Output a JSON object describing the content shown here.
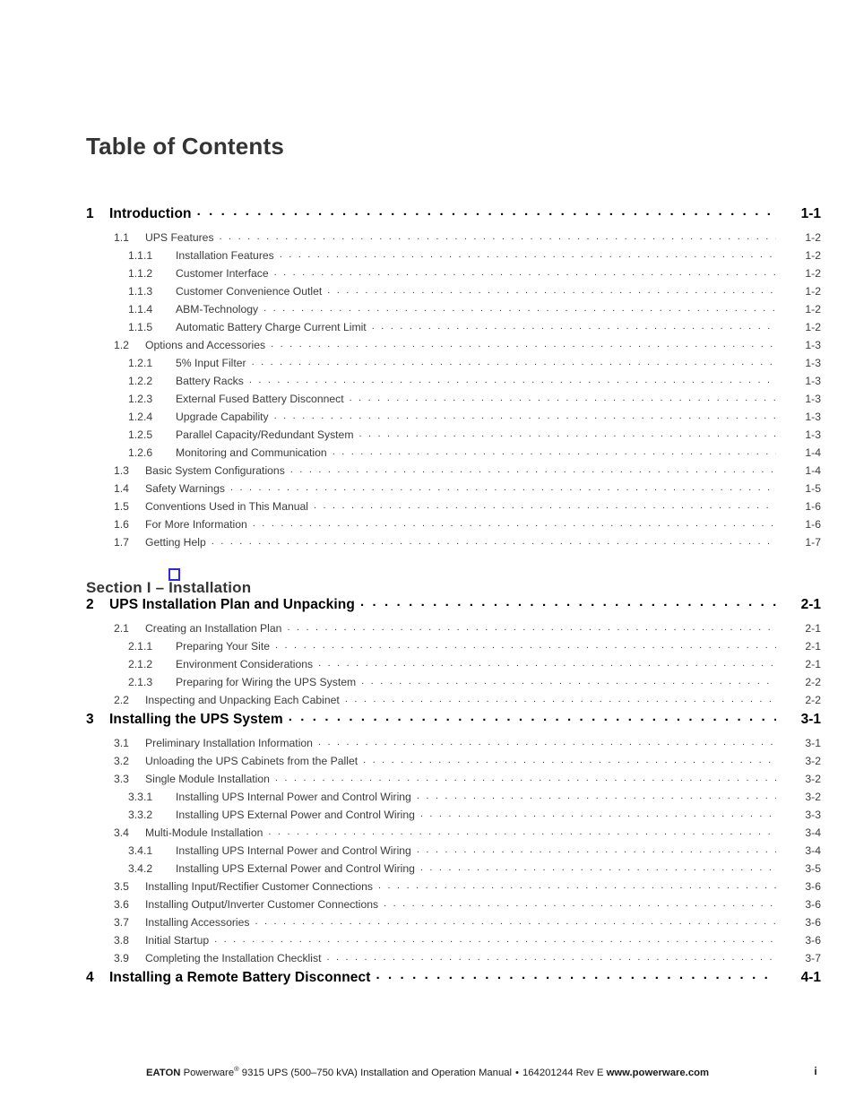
{
  "page_title": "Table of Contents",
  "section_divider": {
    "label": "Section I – Installation"
  },
  "entries": [
    {
      "level": 1,
      "num": "1",
      "label": "Introduction",
      "page": "1-1"
    },
    {
      "level": 2,
      "num": "1.1",
      "label": "UPS Features",
      "page": "1-2"
    },
    {
      "level": 3,
      "num": "1.1.1",
      "label": "Installation Features",
      "page": "1-2"
    },
    {
      "level": 3,
      "num": "1.1.2",
      "label": "Customer Interface",
      "page": "1-2"
    },
    {
      "level": 3,
      "num": "1.1.3",
      "label": "Customer Convenience Outlet",
      "page": "1-2"
    },
    {
      "level": 3,
      "num": "1.1.4",
      "label": "ABM-Technology",
      "page": "1-2"
    },
    {
      "level": 3,
      "num": "1.1.5",
      "label": "Automatic Battery Charge Current Limit",
      "page": "1-2"
    },
    {
      "level": 2,
      "num": "1.2",
      "label": "Options and Accessories",
      "page": "1-3"
    },
    {
      "level": 3,
      "num": "1.2.1",
      "label": "5% Input Filter",
      "page": "1-3"
    },
    {
      "level": 3,
      "num": "1.2.2",
      "label": "Battery Racks",
      "page": "1-3"
    },
    {
      "level": 3,
      "num": "1.2.3",
      "label": "External Fused Battery Disconnect",
      "page": "1-3"
    },
    {
      "level": 3,
      "num": "1.2.4",
      "label": "Upgrade Capability",
      "page": "1-3"
    },
    {
      "level": 3,
      "num": "1.2.5",
      "label": "Parallel Capacity/Redundant System",
      "page": "1-3"
    },
    {
      "level": 3,
      "num": "1.2.6",
      "label": "Monitoring and Communication",
      "page": "1-4"
    },
    {
      "level": 2,
      "num": "1.3",
      "label": "Basic System Configurations",
      "page": "1-4"
    },
    {
      "level": 2,
      "num": "1.4",
      "label": "Safety Warnings",
      "page": "1-5"
    },
    {
      "level": 2,
      "num": "1.5",
      "label": "Conventions Used in This Manual",
      "page": "1-6"
    },
    {
      "level": 2,
      "num": "1.6",
      "label": "For More Information",
      "page": "1-6"
    },
    {
      "level": 2,
      "num": "1.7",
      "label": "Getting Help",
      "page": "1-7"
    },
    {
      "level": 0,
      "num": "",
      "label": "Section I – Installation",
      "page": ""
    },
    {
      "level": 1,
      "num": "2",
      "label": "UPS Installation Plan and Unpacking",
      "page": "2-1"
    },
    {
      "level": 2,
      "num": "2.1",
      "label": "Creating an Installation Plan",
      "page": "2-1"
    },
    {
      "level": 3,
      "num": "2.1.1",
      "label": "Preparing Your Site",
      "page": "2-1"
    },
    {
      "level": 3,
      "num": "2.1.2",
      "label": "Environment Considerations",
      "page": "2-1"
    },
    {
      "level": 3,
      "num": "2.1.3",
      "label": "Preparing for Wiring the UPS System",
      "page": "2-2"
    },
    {
      "level": 2,
      "num": "2.2",
      "label": "Inspecting and Unpacking Each Cabinet",
      "page": "2-2"
    },
    {
      "level": 1,
      "num": "3",
      "label": "Installing the UPS System",
      "page": "3-1"
    },
    {
      "level": 2,
      "num": "3.1",
      "label": "Preliminary Installation Information",
      "page": "3-1"
    },
    {
      "level": 2,
      "num": "3.2",
      "label": "Unloading the UPS Cabinets from the Pallet",
      "page": "3-2"
    },
    {
      "level": 2,
      "num": "3.3",
      "label": "Single Module Installation",
      "page": "3-2"
    },
    {
      "level": 3,
      "num": "3.3.1",
      "label": "Installing UPS Internal Power and Control Wiring",
      "page": "3-2"
    },
    {
      "level": 3,
      "num": "3.3.2",
      "label": "Installing UPS External Power and Control Wiring",
      "page": "3-3"
    },
    {
      "level": 2,
      "num": "3.4",
      "label": "Multi-Module Installation",
      "page": "3-4"
    },
    {
      "level": 3,
      "num": "3.4.1",
      "label": "Installing UPS Internal Power and Control Wiring",
      "page": "3-4"
    },
    {
      "level": 3,
      "num": "3.4.2",
      "label": "Installing UPS External Power and Control Wiring",
      "page": "3-5"
    },
    {
      "level": 2,
      "num": "3.5",
      "label": "Installing Input/Rectifier Customer Connections",
      "page": "3-6"
    },
    {
      "level": 2,
      "num": "3.6",
      "label": "Installing Output/Inverter Customer Connections",
      "page": "3-6"
    },
    {
      "level": 2,
      "num": "3.7",
      "label": "Installing Accessories",
      "page": "3-6"
    },
    {
      "level": 2,
      "num": "3.8",
      "label": "Initial Startup",
      "page": "3-6"
    },
    {
      "level": 2,
      "num": "3.9",
      "label": "Completing the Installation Checklist",
      "page": "3-7"
    },
    {
      "level": 1,
      "num": "4",
      "label": "Installing a Remote Battery Disconnect",
      "page": "4-1"
    }
  ],
  "footer": {
    "brand": "EATON",
    "product": "Powerware",
    "registered": "®",
    "description": "9315 UPS (500–750 kVA) Installation and Operation Manual",
    "bullet": "•",
    "doc_number": "164201244 Rev E",
    "website": "www.powerware.com",
    "page_number": "i"
  },
  "annotation": {
    "type": "blue-selection-box",
    "color": "#2a2ad8"
  }
}
